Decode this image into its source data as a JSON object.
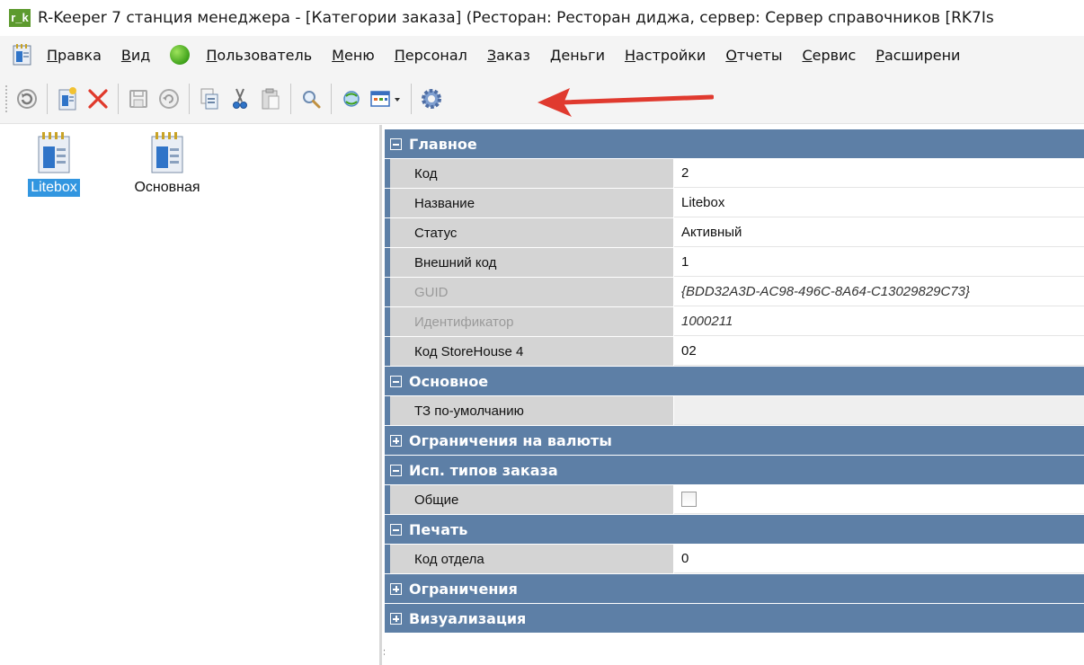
{
  "window": {
    "logo": "r_k",
    "title": "R-Keeper 7 станция менеджера - [Категории заказа] (Ресторан: Ресторан диджа, сервер: Сервер справочников [RK7Is"
  },
  "menu": {
    "items": [
      {
        "label": "Правка",
        "underline": "П",
        "rest": "равка"
      },
      {
        "label": "Вид",
        "underline": "В",
        "rest": "ид"
      },
      {
        "label": "Пользователь",
        "underline": "П",
        "rest": "ользователь"
      },
      {
        "label": "Меню",
        "underline": "М",
        "rest": "еню"
      },
      {
        "label": "Персонал",
        "underline": "П",
        "rest": "ерсонал"
      },
      {
        "label": "Заказ",
        "underline": "З",
        "rest": "аказ"
      },
      {
        "label": "Деньги",
        "underline": "Д",
        "rest": "еньги"
      },
      {
        "label": "Настройки",
        "underline": "Н",
        "rest": "астройки"
      },
      {
        "label": "Отчеты",
        "underline": "О",
        "rest": "тчеты"
      },
      {
        "label": "Сервис",
        "underline": "С",
        "rest": "ервис"
      },
      {
        "label": "Расширения",
        "underline": "Р",
        "rest": "асширени"
      }
    ]
  },
  "categories": [
    {
      "label": "Litebox",
      "selected": true
    },
    {
      "label": "Основная",
      "selected": false
    }
  ],
  "groups": {
    "main": {
      "title": "Главное",
      "collapsed": false
    },
    "basic": {
      "title": "Основное",
      "collapsed": false
    },
    "currency": {
      "title": "Ограничения на валюты",
      "collapsed": true
    },
    "ordertypes": {
      "title": "Исп. типов заказа",
      "collapsed": false
    },
    "print": {
      "title": "Печать",
      "collapsed": false
    },
    "limits": {
      "title": "Ограничения",
      "collapsed": true
    },
    "visual": {
      "title": "Визуализация",
      "collapsed": true
    }
  },
  "props": {
    "code": {
      "name": "Код",
      "value": "2"
    },
    "title": {
      "name": "Название",
      "value": "Litebox"
    },
    "status": {
      "name": "Статус",
      "value": "Активный"
    },
    "extcode": {
      "name": "Внешний код",
      "value": "1"
    },
    "guid": {
      "name": "GUID",
      "value": "{BDD32A3D-AC98-496C-8A64-C13029829C73}"
    },
    "ident": {
      "name": "Идентификатор",
      "value": "1000211"
    },
    "sh4": {
      "name": "Код StoreHouse 4",
      "value": "02"
    },
    "deftz": {
      "name": "ТЗ по-умолчанию",
      "value": ""
    },
    "common": {
      "name": "Общие",
      "checked": false
    },
    "dept": {
      "name": "Код отдела",
      "value": "0"
    }
  },
  "colors": {
    "group_header": "#5d7fa6",
    "prop_name_bg": "#d4d4d4",
    "selection": "#3296e0",
    "annotation_arrow": "#e03a2f",
    "logo_bg": "#5d9a2e"
  }
}
